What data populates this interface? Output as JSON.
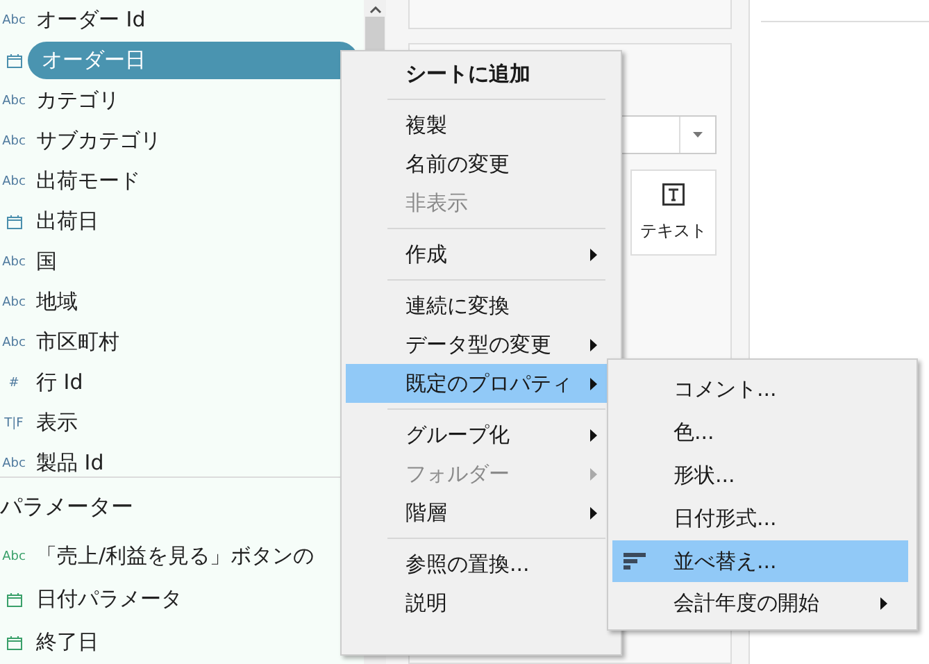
{
  "fields": [
    {
      "name": "オーダー Id",
      "kind": "string",
      "badge": "Abc",
      "selected": false
    },
    {
      "name": "オーダー日",
      "kind": "date",
      "selected": true
    },
    {
      "name": "カテゴリ",
      "kind": "string",
      "badge": "Abc",
      "selected": false
    },
    {
      "name": "サブカテゴリ",
      "kind": "string",
      "badge": "Abc",
      "selected": false
    },
    {
      "name": "出荷モード",
      "kind": "string",
      "badge": "Abc",
      "selected": false
    },
    {
      "name": "出荷日",
      "kind": "date",
      "selected": false
    },
    {
      "name": "国",
      "kind": "string",
      "badge": "Abc",
      "selected": false
    },
    {
      "name": "地域",
      "kind": "string",
      "badge": "Abc",
      "selected": false
    },
    {
      "name": "市区町村",
      "kind": "string",
      "badge": "Abc",
      "selected": false
    },
    {
      "name": "行 Id",
      "kind": "number",
      "badge": "#",
      "selected": false
    },
    {
      "name": "表示",
      "kind": "boolean",
      "badge": "T|F",
      "selected": false
    },
    {
      "name": "製品 Id",
      "kind": "string",
      "badge": "Abc",
      "selected": false
    }
  ],
  "parameters_header": "パラメーター",
  "parameters": [
    {
      "name": "「売上/利益を見る」ボタンの",
      "kind": "string",
      "badge": "Abc",
      "selected": false
    },
    {
      "name": "日付パラメータ",
      "kind": "date",
      "selected": false
    },
    {
      "name": "終了日",
      "kind": "date",
      "selected": false
    }
  ],
  "marks_card": {
    "text_button": "テキスト"
  },
  "context_menu": [
    {
      "kind": "default",
      "label": "シートに追加",
      "disabled": false,
      "submenu": false,
      "selected": false
    },
    {
      "kind": "separator"
    },
    {
      "kind": "item",
      "label": "複製",
      "disabled": false,
      "submenu": false,
      "selected": false
    },
    {
      "kind": "item",
      "label": "名前の変更",
      "disabled": false,
      "submenu": false,
      "selected": false
    },
    {
      "kind": "item",
      "label": "非表示",
      "disabled": true,
      "submenu": false,
      "selected": false
    },
    {
      "kind": "separator"
    },
    {
      "kind": "item",
      "label": "作成",
      "disabled": false,
      "submenu": true,
      "selected": false
    },
    {
      "kind": "separator"
    },
    {
      "kind": "item",
      "label": "連続に変換",
      "disabled": false,
      "submenu": false,
      "selected": false
    },
    {
      "kind": "item",
      "label": "データ型の変更",
      "disabled": false,
      "submenu": true,
      "selected": false
    },
    {
      "kind": "item",
      "label": "既定のプロパティ",
      "disabled": false,
      "submenu": true,
      "selected": true
    },
    {
      "kind": "separator"
    },
    {
      "kind": "item",
      "label": "グループ化",
      "disabled": false,
      "submenu": true,
      "selected": false
    },
    {
      "kind": "item",
      "label": "フォルダー",
      "disabled": true,
      "submenu": true,
      "selected": false
    },
    {
      "kind": "item",
      "label": "階層",
      "disabled": false,
      "submenu": true,
      "selected": false
    },
    {
      "kind": "separator"
    },
    {
      "kind": "item",
      "label": "参照の置換...",
      "disabled": false,
      "submenu": false,
      "selected": false
    },
    {
      "kind": "item",
      "label": "説明",
      "disabled": false,
      "submenu": false,
      "selected": false
    }
  ],
  "submenu": [
    {
      "kind": "item",
      "label": "コメント...",
      "submenu": false,
      "selected": false
    },
    {
      "kind": "item",
      "label": "色...",
      "submenu": false,
      "selected": false
    },
    {
      "kind": "item",
      "label": "形状...",
      "submenu": false,
      "selected": false
    },
    {
      "kind": "item",
      "label": "日付形式...",
      "submenu": false,
      "selected": false
    },
    {
      "kind": "sort",
      "label": "並べ替え...",
      "submenu": false,
      "selected": true
    },
    {
      "kind": "item",
      "label": "会計年度の開始",
      "submenu": true,
      "selected": false
    }
  ]
}
